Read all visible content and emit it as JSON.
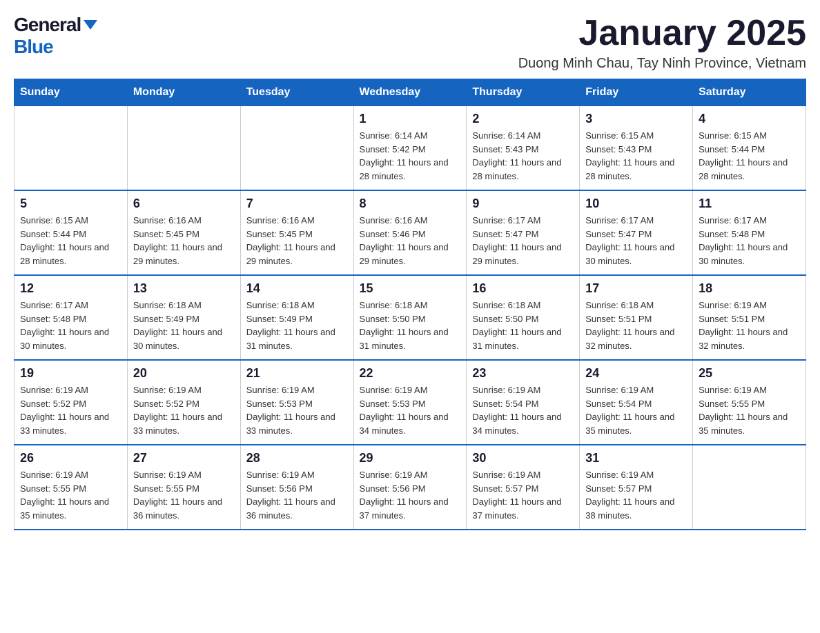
{
  "logo": {
    "general": "General",
    "blue": "Blue"
  },
  "title": "January 2025",
  "location": "Duong Minh Chau, Tay Ninh Province, Vietnam",
  "days_of_week": [
    "Sunday",
    "Monday",
    "Tuesday",
    "Wednesday",
    "Thursday",
    "Friday",
    "Saturday"
  ],
  "weeks": [
    [
      {
        "day": "",
        "info": ""
      },
      {
        "day": "",
        "info": ""
      },
      {
        "day": "",
        "info": ""
      },
      {
        "day": "1",
        "info": "Sunrise: 6:14 AM\nSunset: 5:42 PM\nDaylight: 11 hours and 28 minutes."
      },
      {
        "day": "2",
        "info": "Sunrise: 6:14 AM\nSunset: 5:43 PM\nDaylight: 11 hours and 28 minutes."
      },
      {
        "day": "3",
        "info": "Sunrise: 6:15 AM\nSunset: 5:43 PM\nDaylight: 11 hours and 28 minutes."
      },
      {
        "day": "4",
        "info": "Sunrise: 6:15 AM\nSunset: 5:44 PM\nDaylight: 11 hours and 28 minutes."
      }
    ],
    [
      {
        "day": "5",
        "info": "Sunrise: 6:15 AM\nSunset: 5:44 PM\nDaylight: 11 hours and 28 minutes."
      },
      {
        "day": "6",
        "info": "Sunrise: 6:16 AM\nSunset: 5:45 PM\nDaylight: 11 hours and 29 minutes."
      },
      {
        "day": "7",
        "info": "Sunrise: 6:16 AM\nSunset: 5:45 PM\nDaylight: 11 hours and 29 minutes."
      },
      {
        "day": "8",
        "info": "Sunrise: 6:16 AM\nSunset: 5:46 PM\nDaylight: 11 hours and 29 minutes."
      },
      {
        "day": "9",
        "info": "Sunrise: 6:17 AM\nSunset: 5:47 PM\nDaylight: 11 hours and 29 minutes."
      },
      {
        "day": "10",
        "info": "Sunrise: 6:17 AM\nSunset: 5:47 PM\nDaylight: 11 hours and 30 minutes."
      },
      {
        "day": "11",
        "info": "Sunrise: 6:17 AM\nSunset: 5:48 PM\nDaylight: 11 hours and 30 minutes."
      }
    ],
    [
      {
        "day": "12",
        "info": "Sunrise: 6:17 AM\nSunset: 5:48 PM\nDaylight: 11 hours and 30 minutes."
      },
      {
        "day": "13",
        "info": "Sunrise: 6:18 AM\nSunset: 5:49 PM\nDaylight: 11 hours and 30 minutes."
      },
      {
        "day": "14",
        "info": "Sunrise: 6:18 AM\nSunset: 5:49 PM\nDaylight: 11 hours and 31 minutes."
      },
      {
        "day": "15",
        "info": "Sunrise: 6:18 AM\nSunset: 5:50 PM\nDaylight: 11 hours and 31 minutes."
      },
      {
        "day": "16",
        "info": "Sunrise: 6:18 AM\nSunset: 5:50 PM\nDaylight: 11 hours and 31 minutes."
      },
      {
        "day": "17",
        "info": "Sunrise: 6:18 AM\nSunset: 5:51 PM\nDaylight: 11 hours and 32 minutes."
      },
      {
        "day": "18",
        "info": "Sunrise: 6:19 AM\nSunset: 5:51 PM\nDaylight: 11 hours and 32 minutes."
      }
    ],
    [
      {
        "day": "19",
        "info": "Sunrise: 6:19 AM\nSunset: 5:52 PM\nDaylight: 11 hours and 33 minutes."
      },
      {
        "day": "20",
        "info": "Sunrise: 6:19 AM\nSunset: 5:52 PM\nDaylight: 11 hours and 33 minutes."
      },
      {
        "day": "21",
        "info": "Sunrise: 6:19 AM\nSunset: 5:53 PM\nDaylight: 11 hours and 33 minutes."
      },
      {
        "day": "22",
        "info": "Sunrise: 6:19 AM\nSunset: 5:53 PM\nDaylight: 11 hours and 34 minutes."
      },
      {
        "day": "23",
        "info": "Sunrise: 6:19 AM\nSunset: 5:54 PM\nDaylight: 11 hours and 34 minutes."
      },
      {
        "day": "24",
        "info": "Sunrise: 6:19 AM\nSunset: 5:54 PM\nDaylight: 11 hours and 35 minutes."
      },
      {
        "day": "25",
        "info": "Sunrise: 6:19 AM\nSunset: 5:55 PM\nDaylight: 11 hours and 35 minutes."
      }
    ],
    [
      {
        "day": "26",
        "info": "Sunrise: 6:19 AM\nSunset: 5:55 PM\nDaylight: 11 hours and 35 minutes."
      },
      {
        "day": "27",
        "info": "Sunrise: 6:19 AM\nSunset: 5:55 PM\nDaylight: 11 hours and 36 minutes."
      },
      {
        "day": "28",
        "info": "Sunrise: 6:19 AM\nSunset: 5:56 PM\nDaylight: 11 hours and 36 minutes."
      },
      {
        "day": "29",
        "info": "Sunrise: 6:19 AM\nSunset: 5:56 PM\nDaylight: 11 hours and 37 minutes."
      },
      {
        "day": "30",
        "info": "Sunrise: 6:19 AM\nSunset: 5:57 PM\nDaylight: 11 hours and 37 minutes."
      },
      {
        "day": "31",
        "info": "Sunrise: 6:19 AM\nSunset: 5:57 PM\nDaylight: 11 hours and 38 minutes."
      },
      {
        "day": "",
        "info": ""
      }
    ]
  ]
}
